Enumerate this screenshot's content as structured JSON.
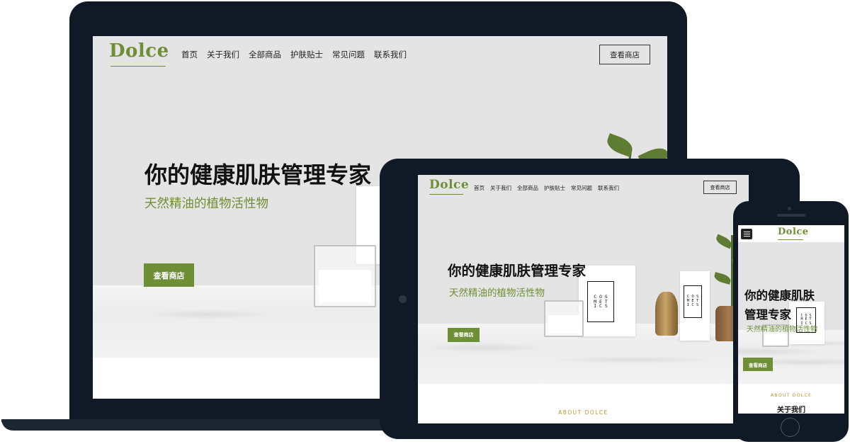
{
  "brand": {
    "name": "Dolce",
    "accent": "#6f8f36",
    "gold": "#b8942e",
    "device_frame": "#0f1a26"
  },
  "nav": {
    "items": [
      "首页",
      "关于我们",
      "全部商品",
      "护肤贴士",
      "常见问题",
      "联系我们"
    ],
    "shop_button": "查看商店"
  },
  "hero": {
    "headline": "你的健康肌肤管理专家",
    "headline_line1": "你的健康肌肤",
    "headline_line2": "管理专家",
    "subline": "天然精油的植物活性物",
    "cta": "查看商店"
  },
  "about": {
    "tag": "ABOUT DOLCE",
    "title": "关于我们"
  },
  "product_box": {
    "lines": [
      "C O S",
      "M E T",
      "I C S"
    ]
  },
  "icons": {
    "menu": "hamburger-menu-icon"
  }
}
